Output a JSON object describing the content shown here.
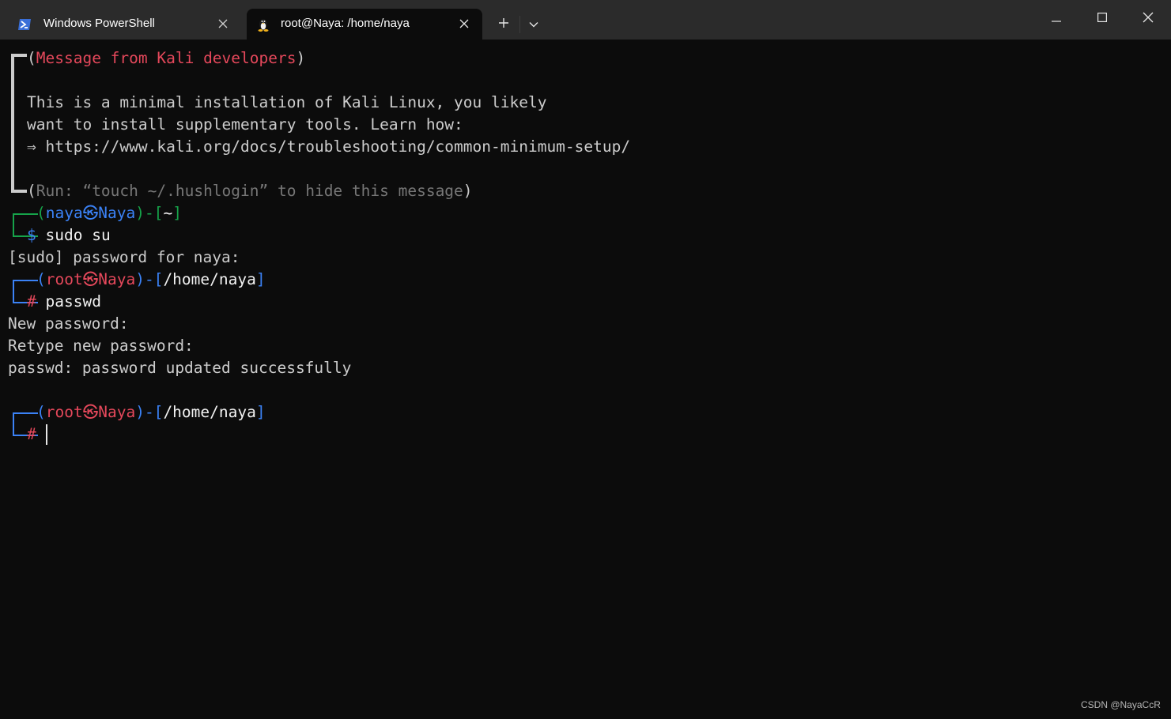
{
  "tabs": [
    {
      "title": "Windows PowerShell",
      "icon": "powershell-icon",
      "active": false
    },
    {
      "title": "root@Naya: /home/naya",
      "icon": "linux-penguin-icon",
      "active": true
    }
  ],
  "window_controls": {
    "minimize_icon": "minimize-icon",
    "maximize_icon": "maximize-icon",
    "close_icon": "close-icon",
    "new_tab_icon": "plus-icon",
    "dropdown_icon": "chevron-down-icon"
  },
  "terminal": {
    "motd": {
      "header_open": "(",
      "header": "Message from Kali developers",
      "header_close": ")",
      "line1": "This is a minimal installation of Kali Linux, you likely",
      "line2": "want to install supplementary tools. Learn how:",
      "line3": "⇒ https://www.kali.org/docs/troubleshooting/common-minimum-setup/",
      "footer_open": "(",
      "footer": "Run: “touch ~/.hushlogin” to hide this message",
      "footer_close": ")"
    },
    "prompt1": {
      "user": "naya",
      "symbol": "㉿",
      "host": "Naya",
      "dir": "~",
      "sigil": "$",
      "command": "sudo su"
    },
    "sudo_prompt": "[sudo] password for naya:",
    "prompt2": {
      "user": "root",
      "symbol": "㉿",
      "host": "Naya",
      "dir": "/home/naya",
      "sigil": "#",
      "command": "passwd"
    },
    "output": [
      "New password:",
      "Retype new password:",
      "passwd: password updated successfully"
    ],
    "prompt3": {
      "user": "root",
      "symbol": "㉿",
      "host": "Naya",
      "dir": "/home/naya",
      "sigil": "#",
      "command": ""
    }
  },
  "watermark": "CSDN @NayaCcR",
  "colors": {
    "background": "#0c0c0c",
    "titlebar": "#2b2b2b",
    "red": "#e5485b",
    "blue": "#3b82f6",
    "green": "#16a34a",
    "grey": "#767676"
  }
}
